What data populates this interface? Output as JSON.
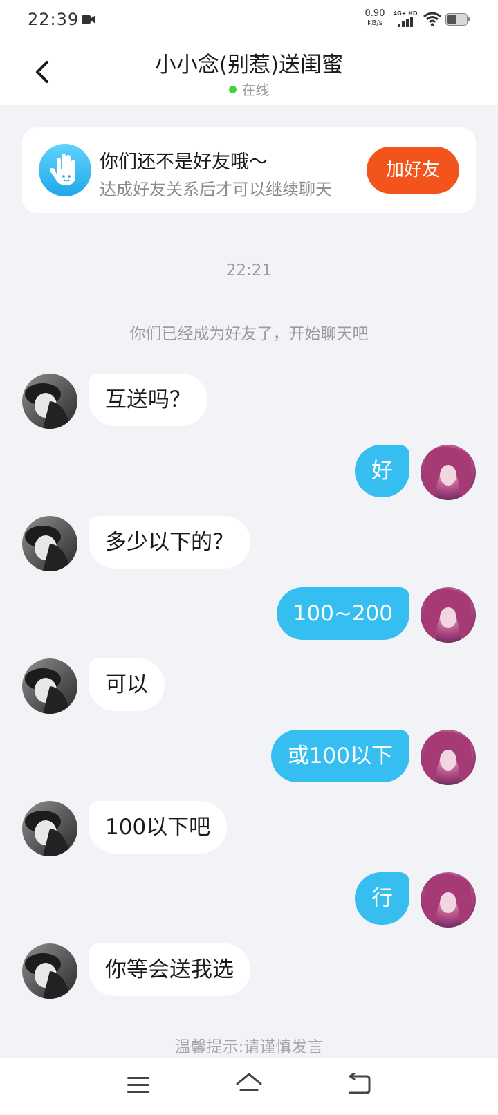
{
  "status_bar": {
    "time": "22:39",
    "net_speed_value": "0.90",
    "net_speed_unit": "KB/s",
    "network_label": "4G+ HD",
    "icons": [
      "video-camera-icon",
      "signal-icon",
      "wifi-icon",
      "battery-icon"
    ]
  },
  "header": {
    "title": "小小念(别惹)送闺蜜",
    "status": "在线",
    "back_icon": "chevron-left-icon"
  },
  "friend_banner": {
    "title": "你们还不是好友哦～",
    "subtitle": "达成好友关系后才可以继续聊天",
    "button": "加好友",
    "icon": "hand-icon"
  },
  "chat": {
    "timestamp": "22:21",
    "system_message": "你们已经成为好友了，开始聊天吧",
    "messages": [
      {
        "side": "in",
        "text": "互送吗？"
      },
      {
        "side": "out",
        "text": "好"
      },
      {
        "side": "in",
        "text": "多少以下的？"
      },
      {
        "side": "out",
        "text": "100~200"
      },
      {
        "side": "in",
        "text": "可以"
      },
      {
        "side": "out",
        "text": "或100以下"
      },
      {
        "side": "in",
        "text": "100以下吧"
      },
      {
        "side": "out",
        "text": "行"
      },
      {
        "side": "in",
        "text": "你等会送我选"
      }
    ]
  },
  "footer_tip": "温馨提示:请谨慎发言",
  "system_nav": {
    "icons": [
      "menu-icon",
      "home-icon",
      "back-icon"
    ]
  },
  "colors": {
    "accent_blue": "#36bef0",
    "add_button": "#f2541b",
    "online": "#3ad63a",
    "background": "#f2f3f7"
  }
}
